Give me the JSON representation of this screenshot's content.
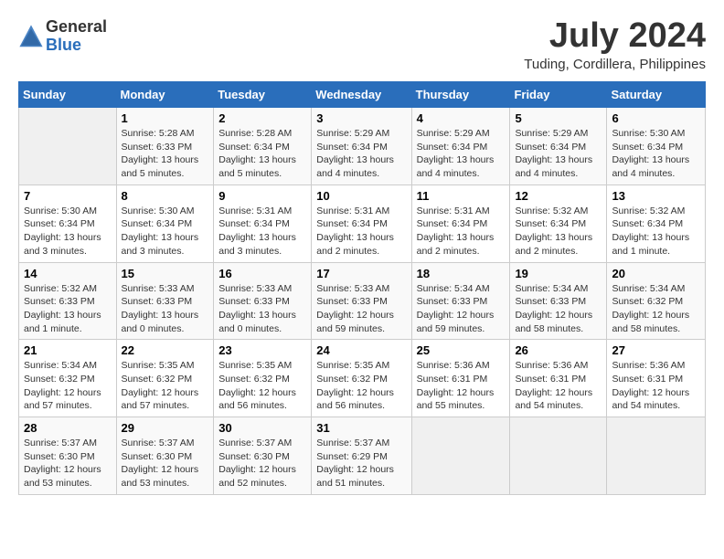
{
  "logo": {
    "general": "General",
    "blue": "Blue"
  },
  "title": {
    "month_year": "July 2024",
    "location": "Tuding, Cordillera, Philippines"
  },
  "days_of_week": [
    "Sunday",
    "Monday",
    "Tuesday",
    "Wednesday",
    "Thursday",
    "Friday",
    "Saturday"
  ],
  "weeks": [
    [
      {
        "day": "",
        "info": ""
      },
      {
        "day": "1",
        "info": "Sunrise: 5:28 AM\nSunset: 6:33 PM\nDaylight: 13 hours\nand 5 minutes."
      },
      {
        "day": "2",
        "info": "Sunrise: 5:28 AM\nSunset: 6:34 PM\nDaylight: 13 hours\nand 5 minutes."
      },
      {
        "day": "3",
        "info": "Sunrise: 5:29 AM\nSunset: 6:34 PM\nDaylight: 13 hours\nand 4 minutes."
      },
      {
        "day": "4",
        "info": "Sunrise: 5:29 AM\nSunset: 6:34 PM\nDaylight: 13 hours\nand 4 minutes."
      },
      {
        "day": "5",
        "info": "Sunrise: 5:29 AM\nSunset: 6:34 PM\nDaylight: 13 hours\nand 4 minutes."
      },
      {
        "day": "6",
        "info": "Sunrise: 5:30 AM\nSunset: 6:34 PM\nDaylight: 13 hours\nand 4 minutes."
      }
    ],
    [
      {
        "day": "7",
        "info": "Sunrise: 5:30 AM\nSunset: 6:34 PM\nDaylight: 13 hours\nand 3 minutes."
      },
      {
        "day": "8",
        "info": "Sunrise: 5:30 AM\nSunset: 6:34 PM\nDaylight: 13 hours\nand 3 minutes."
      },
      {
        "day": "9",
        "info": "Sunrise: 5:31 AM\nSunset: 6:34 PM\nDaylight: 13 hours\nand 3 minutes."
      },
      {
        "day": "10",
        "info": "Sunrise: 5:31 AM\nSunset: 6:34 PM\nDaylight: 13 hours\nand 2 minutes."
      },
      {
        "day": "11",
        "info": "Sunrise: 5:31 AM\nSunset: 6:34 PM\nDaylight: 13 hours\nand 2 minutes."
      },
      {
        "day": "12",
        "info": "Sunrise: 5:32 AM\nSunset: 6:34 PM\nDaylight: 13 hours\nand 2 minutes."
      },
      {
        "day": "13",
        "info": "Sunrise: 5:32 AM\nSunset: 6:34 PM\nDaylight: 13 hours\nand 1 minute."
      }
    ],
    [
      {
        "day": "14",
        "info": "Sunrise: 5:32 AM\nSunset: 6:33 PM\nDaylight: 13 hours\nand 1 minute."
      },
      {
        "day": "15",
        "info": "Sunrise: 5:33 AM\nSunset: 6:33 PM\nDaylight: 13 hours\nand 0 minutes."
      },
      {
        "day": "16",
        "info": "Sunrise: 5:33 AM\nSunset: 6:33 PM\nDaylight: 13 hours\nand 0 minutes."
      },
      {
        "day": "17",
        "info": "Sunrise: 5:33 AM\nSunset: 6:33 PM\nDaylight: 12 hours\nand 59 minutes."
      },
      {
        "day": "18",
        "info": "Sunrise: 5:34 AM\nSunset: 6:33 PM\nDaylight: 12 hours\nand 59 minutes."
      },
      {
        "day": "19",
        "info": "Sunrise: 5:34 AM\nSunset: 6:33 PM\nDaylight: 12 hours\nand 58 minutes."
      },
      {
        "day": "20",
        "info": "Sunrise: 5:34 AM\nSunset: 6:32 PM\nDaylight: 12 hours\nand 58 minutes."
      }
    ],
    [
      {
        "day": "21",
        "info": "Sunrise: 5:34 AM\nSunset: 6:32 PM\nDaylight: 12 hours\nand 57 minutes."
      },
      {
        "day": "22",
        "info": "Sunrise: 5:35 AM\nSunset: 6:32 PM\nDaylight: 12 hours\nand 57 minutes."
      },
      {
        "day": "23",
        "info": "Sunrise: 5:35 AM\nSunset: 6:32 PM\nDaylight: 12 hours\nand 56 minutes."
      },
      {
        "day": "24",
        "info": "Sunrise: 5:35 AM\nSunset: 6:32 PM\nDaylight: 12 hours\nand 56 minutes."
      },
      {
        "day": "25",
        "info": "Sunrise: 5:36 AM\nSunset: 6:31 PM\nDaylight: 12 hours\nand 55 minutes."
      },
      {
        "day": "26",
        "info": "Sunrise: 5:36 AM\nSunset: 6:31 PM\nDaylight: 12 hours\nand 54 minutes."
      },
      {
        "day": "27",
        "info": "Sunrise: 5:36 AM\nSunset: 6:31 PM\nDaylight: 12 hours\nand 54 minutes."
      }
    ],
    [
      {
        "day": "28",
        "info": "Sunrise: 5:37 AM\nSunset: 6:30 PM\nDaylight: 12 hours\nand 53 minutes."
      },
      {
        "day": "29",
        "info": "Sunrise: 5:37 AM\nSunset: 6:30 PM\nDaylight: 12 hours\nand 53 minutes."
      },
      {
        "day": "30",
        "info": "Sunrise: 5:37 AM\nSunset: 6:30 PM\nDaylight: 12 hours\nand 52 minutes."
      },
      {
        "day": "31",
        "info": "Sunrise: 5:37 AM\nSunset: 6:29 PM\nDaylight: 12 hours\nand 51 minutes."
      },
      {
        "day": "",
        "info": ""
      },
      {
        "day": "",
        "info": ""
      },
      {
        "day": "",
        "info": ""
      }
    ]
  ]
}
